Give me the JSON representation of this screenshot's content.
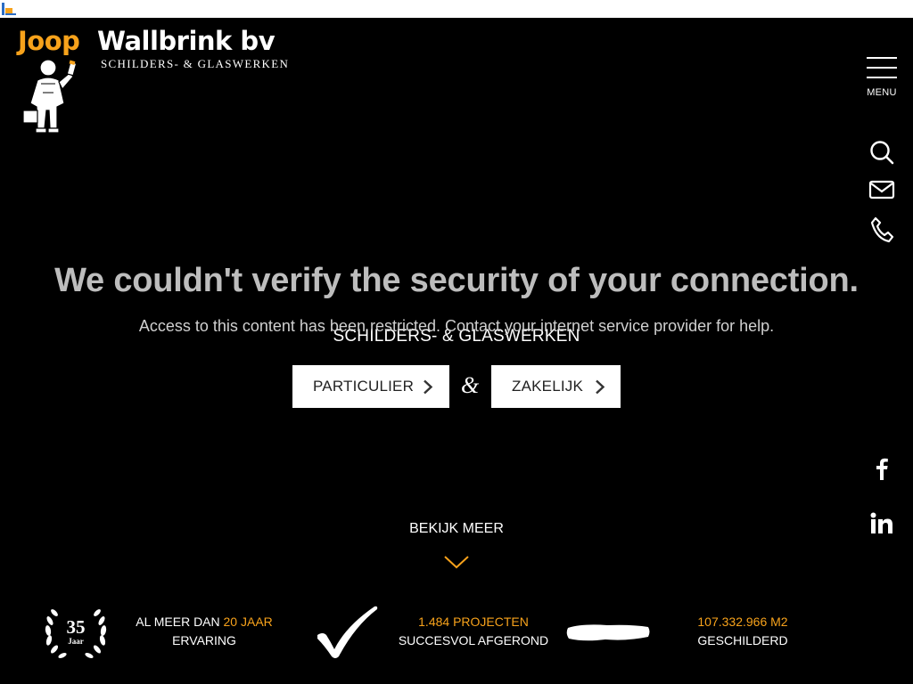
{
  "logo": {
    "first_word": "Joop",
    "second_word": "Wallbrink bv",
    "subtitle": "SCHILDERS- & GLASWERKEN",
    "figure_icon": "painter-illustration"
  },
  "nav": {
    "menu_label": "MENU",
    "icons": [
      "search-icon",
      "mail-icon",
      "phone-icon"
    ],
    "social_icons": [
      "facebook-icon",
      "linkedin-icon"
    ]
  },
  "error_overlay": {
    "title": "We couldn't verify the security of your connection.",
    "description": "Access to this content has been restricted. Contact your internet service provider for help."
  },
  "hero": {
    "subtitle": "SCHILDERS- & GLASWERKEN",
    "button_left": "PARTICULIER",
    "ampersand": "&",
    "button_right": "ZAKELIJK",
    "more_label": "BEKIJK MEER"
  },
  "stats": {
    "badge_number": "35",
    "badge_label": "Jaar",
    "experience": {
      "prefix": "AL MEER DAN ",
      "highlight": "20 JAAR",
      "line2": "ERVARING"
    },
    "projects": {
      "highlight": "1.484 PROJECTEN",
      "line2": "SUCCESVOL AFGEROND"
    },
    "painted": {
      "highlight": "107.332.966 M2",
      "line2": "GESCHILDERD"
    }
  },
  "colors": {
    "background": "#000000",
    "accent": "#f7a21b",
    "text": "#ffffff",
    "error_title": "#bdbdbd"
  }
}
